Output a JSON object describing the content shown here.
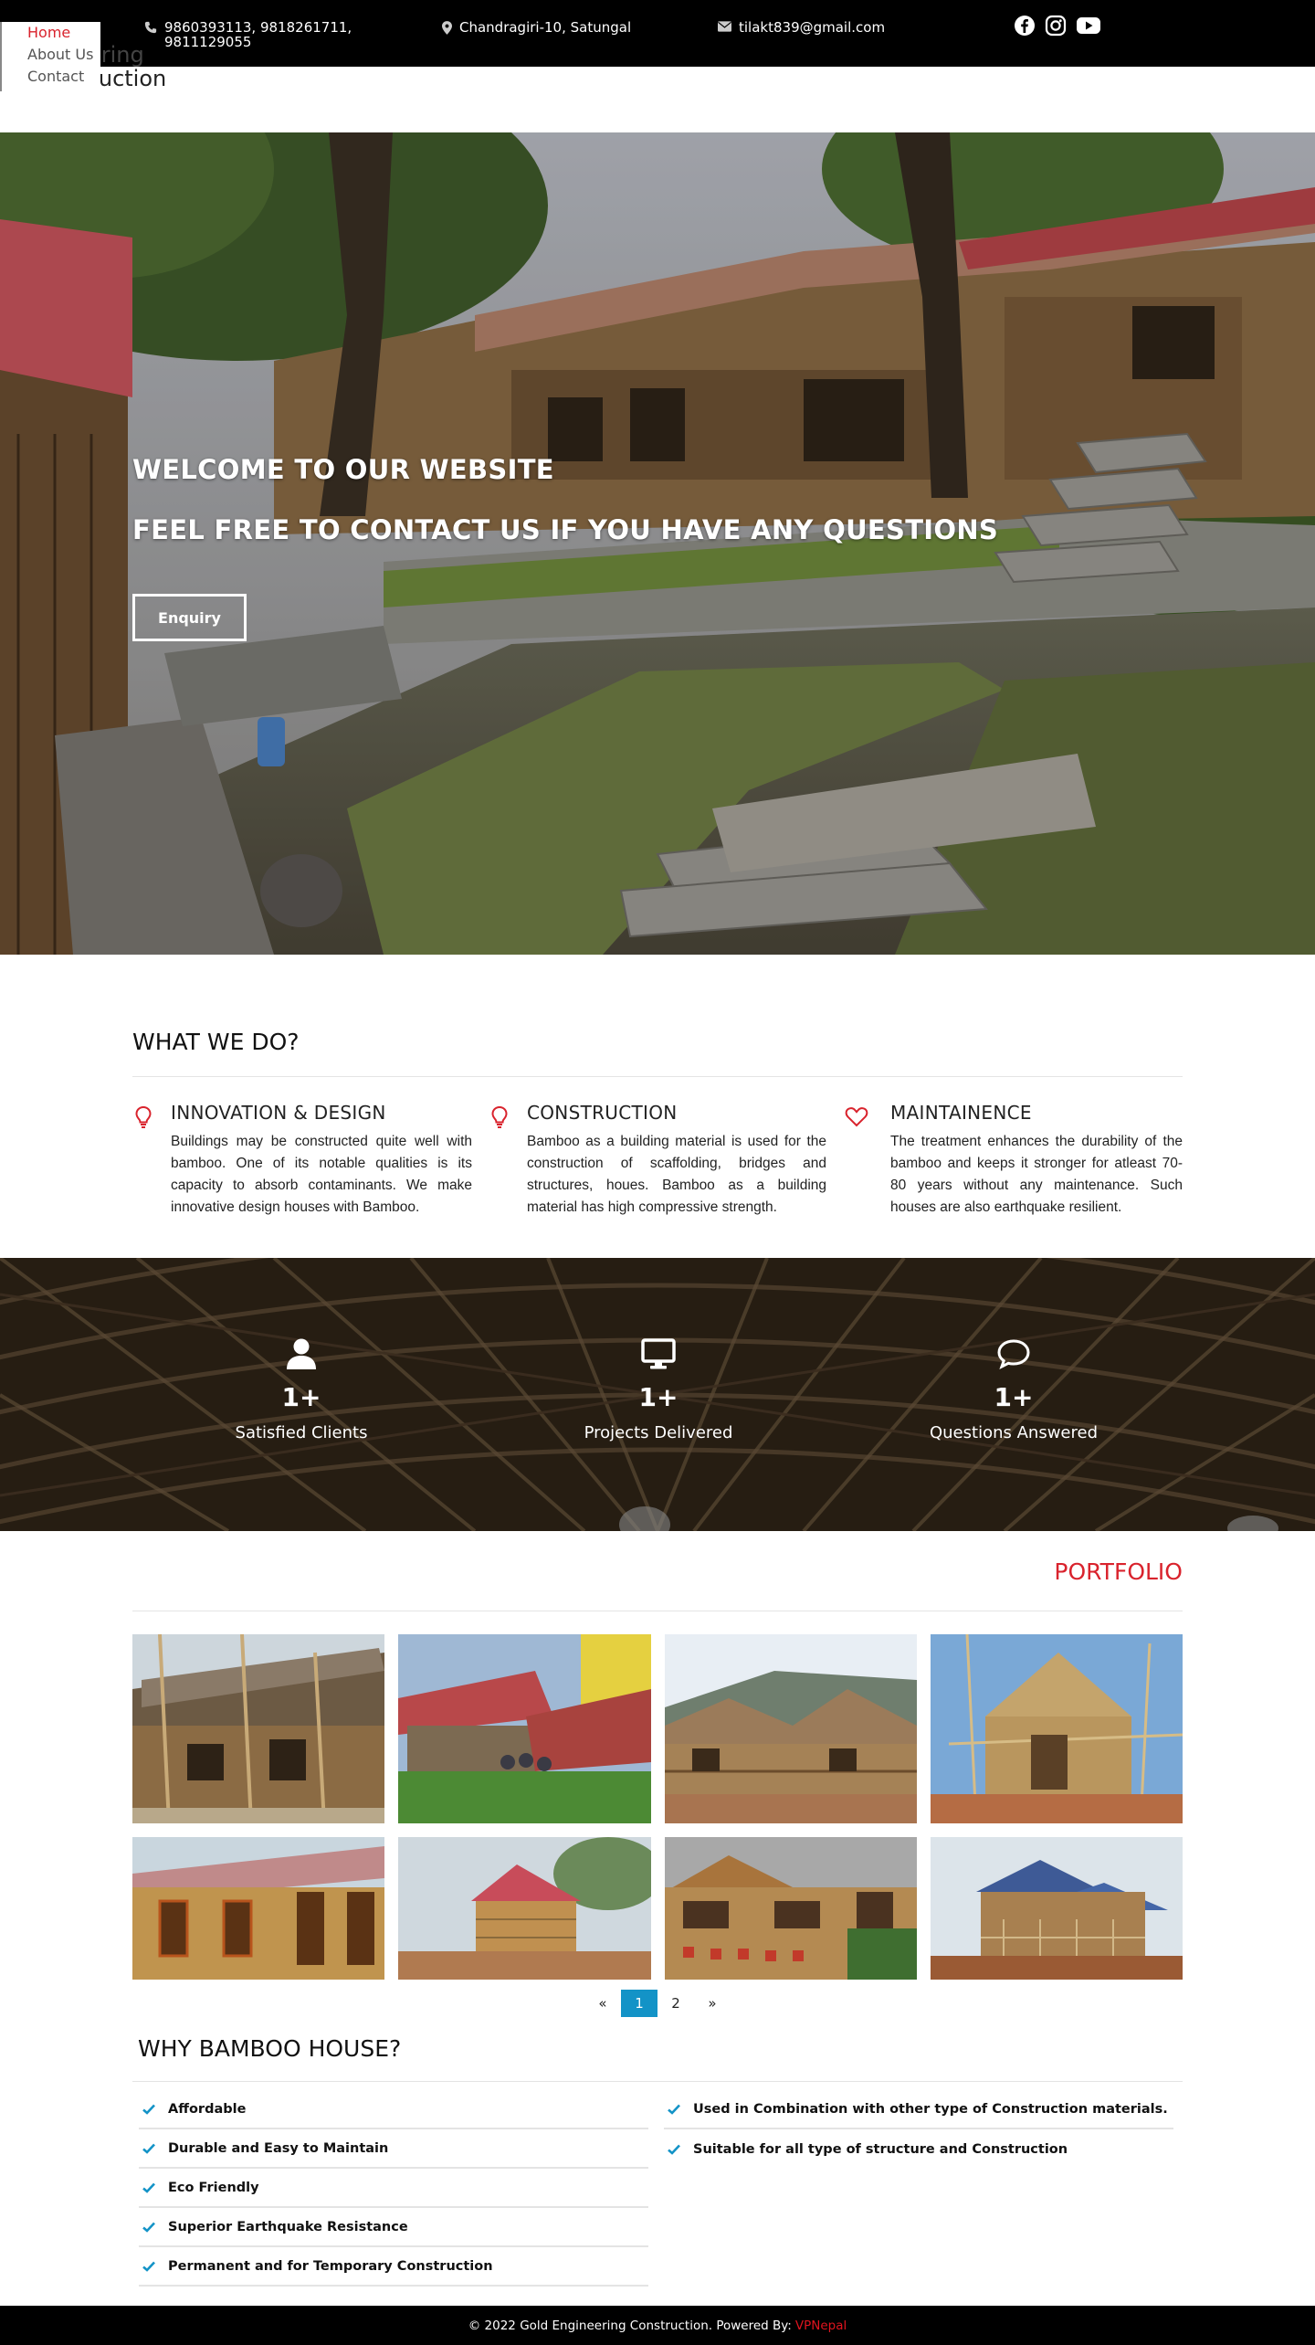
{
  "topbar": {
    "phone": "9860393113, 9818261711, 9811129055",
    "address": "Chandragiri-10, Satungal",
    "email": "tilakt839@gmail.com",
    "social_icons": [
      "facebook-icon",
      "instagram-icon",
      "youtube-icon"
    ]
  },
  "brand": {
    "line1": "ering",
    "line2": "ruction"
  },
  "nav": {
    "items": [
      "Home",
      "About Us",
      "Contact"
    ],
    "active": "Home"
  },
  "hero": {
    "heading1": "WELCOME TO OUR WEBSITE",
    "heading2": "FEEL FREE TO CONTACT US IF YOU HAVE ANY QUESTIONS",
    "button": "Enquiry"
  },
  "what_we_do": {
    "title": "WHAT WE DO?",
    "services": [
      {
        "icon": "lightbulb-icon",
        "title": "INNOVATION & DESIGN",
        "text": "Buildings may be constructed quite well with bamboo. One of its notable qualities is its capacity to absorb contaminants. We make innovative design houses with Bamboo."
      },
      {
        "icon": "lightbulb-icon",
        "title": "CONSTRUCTION",
        "text": "Bamboo as a building material is used for the construction of scaffolding, bridges and structures, houes. Bamboo as a building material has high compressive strength."
      },
      {
        "icon": "heart-icon",
        "title": "MAINTAINENCE",
        "text": "The treatment enhances the durability of the bamboo and keeps it stronger for atleast 70-80 years without any maintenance. Such houses are also earthquake resilient."
      }
    ]
  },
  "stats": [
    {
      "icon": "user-icon",
      "value": "1+",
      "label": "Satisfied Clients"
    },
    {
      "icon": "monitor-icon",
      "value": "1+",
      "label": "Projects Delivered"
    },
    {
      "icon": "chat-icon",
      "value": "1+",
      "label": "Questions Answered"
    }
  ],
  "portfolio": {
    "title": "PORTFOLIO",
    "pagination": {
      "prev": "«",
      "pages": [
        "1",
        "2"
      ],
      "current": "1",
      "next": "»"
    }
  },
  "why": {
    "title": "WHY BAMBOO HOUSE?",
    "left": [
      "Affordable",
      "Durable and Easy to Maintain",
      "Eco Friendly",
      "Superior Earthquake Resistance",
      "Permanent and for Temporary Construction"
    ],
    "right": [
      "Used in Combination with other type of Construction materials.",
      "Suitable for all type of structure and Construction"
    ]
  },
  "footer": {
    "text": "© 2022 Gold Engineering Construction. Powered By:",
    "powered": "VPNepal"
  },
  "colors": {
    "accent": "#d9232d",
    "pager_active": "#1393c7",
    "check": "#1393c7",
    "topbar": "#000000"
  }
}
